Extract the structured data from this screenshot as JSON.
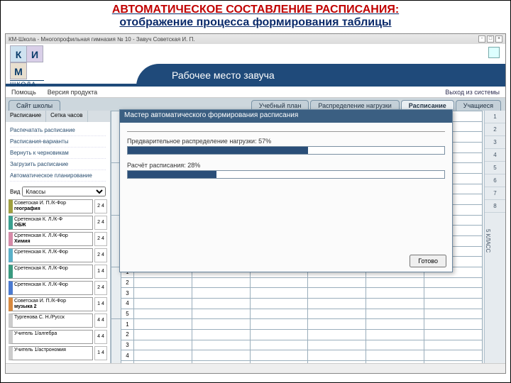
{
  "slide": {
    "title_red": "АВТОМАТИЧЕСКОЕ СОСТАВЛЕНИЕ РАСПИСАНИЯ:",
    "title_rest": "отображение процесса формирования таблицы"
  },
  "titlebar": {
    "text": "КМ-Школа - Многопрофильная гимназия № 10 - Завуч Советская И. П."
  },
  "logo": {
    "k": "К",
    "i": "И",
    "m": "М",
    "label": "ШКОЛА"
  },
  "header": {
    "workspace_title": "Рабочее место завуча",
    "logout": "Выход из системы"
  },
  "menubar": {
    "items": [
      "Помощь",
      "Версия продукта"
    ]
  },
  "tabs": {
    "items": [
      {
        "label": "Сайт школы"
      },
      {
        "label": "Учебный план"
      },
      {
        "label": "Распределение нагрузки"
      },
      {
        "label": "Расписание",
        "active": true
      },
      {
        "label": "Учащиеся"
      }
    ]
  },
  "subtab": {
    "left": "Расписание",
    "right": "Сетка часов"
  },
  "nav": {
    "items": [
      "Распечатать расписание",
      "Расписания-варианты",
      "Вернуть к черновикам",
      "Загрузить расписание",
      "Автоматическое планирование"
    ]
  },
  "filter": {
    "label": "Вид",
    "value": "Классы"
  },
  "teachers": [
    {
      "name": "Советская И. П./К-Фор",
      "subj": "география",
      "hours": "2 4",
      "color": "c-olive"
    },
    {
      "name": "Сретенская К. Л./К-Ф",
      "subj": "ОБЖ",
      "hours": "2 4",
      "color": "c-teal"
    },
    {
      "name": "Сретенская К. Л./К-Фор",
      "subj": "Химия",
      "hours": "2 4",
      "color": "c-pink"
    },
    {
      "name": "Сретенская К. Л./К-Фор",
      "subj": "",
      "hours": "2 4",
      "color": "c-cyan"
    },
    {
      "name": "Сретенская К. Л./К-Фор",
      "subj": "",
      "hours": "1 4",
      "color": "c-teal2"
    },
    {
      "name": "Сретенская К. Л./К-Фор",
      "subj": "",
      "hours": "2 4",
      "color": "c-blue"
    },
    {
      "name": "Советская И. П./К-Фор",
      "subj": "музыка 2",
      "hours": "1 4",
      "color": "c-orange"
    },
    {
      "name": "Тургенова С. Н./Русск",
      "subj": "",
      "hours": "4 4",
      "color": "c-none"
    },
    {
      "name": "Учитель 1/алгебра",
      "subj": "",
      "hours": "4 4",
      "color": "c-none"
    },
    {
      "name": "Учитель 1/астрономия",
      "subj": "",
      "hours": "1 4",
      "color": "c-none"
    }
  ],
  "right": {
    "nums": [
      "1",
      "2",
      "3",
      "4",
      "5",
      "6",
      "7",
      "8"
    ],
    "vlabel": "5 КЛАСС"
  },
  "modal": {
    "title": "Мастер автоматического формирования расписания",
    "p1_label": "Предварительное распределение нагрузки: 57%",
    "p1_pct": 57,
    "p2_label": "Расчёт расписания: 28%",
    "p2_pct": 28,
    "done": "Готово"
  }
}
